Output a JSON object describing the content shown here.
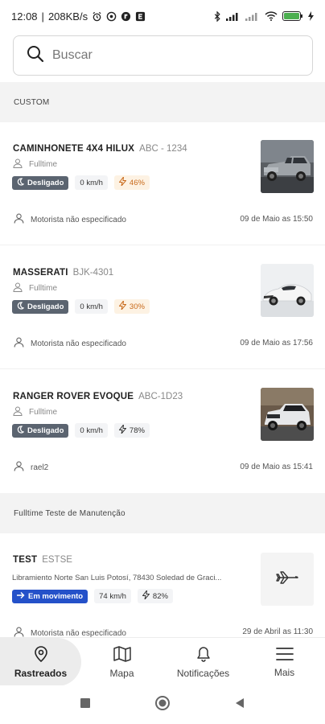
{
  "status_bar": {
    "time": "12:08",
    "speed": "208KB/s",
    "battery_icon": "battery-icon"
  },
  "search": {
    "placeholder": "Buscar"
  },
  "sections": [
    {
      "title": "CUSTOM",
      "vehicles": [
        {
          "name": "CAMINHONETE 4X4 HILUX",
          "plate": "ABC - 1234",
          "group": "Fulltime",
          "status": "Desligado",
          "speed": "0 km/h",
          "battery": "46%",
          "driver": "Motorista não especificado",
          "time": "09 de Maio as 15:50",
          "image": "pickup-truck-photo"
        },
        {
          "name": "MASSERATI",
          "plate": "BJK-4301",
          "group": "Fulltime",
          "status": "Desligado",
          "speed": "0 km/h",
          "battery": "30%",
          "driver": "Motorista não especificado",
          "time": "09 de Maio as 17:56",
          "image": "sports-car-photo"
        },
        {
          "name": "RANGER ROVER EVOQUE",
          "plate": "ABC-1D23",
          "group": "Fulltime",
          "status": "Desligado",
          "speed": "0 km/h",
          "battery": "78%",
          "driver": "rael2",
          "time": "09 de Maio as 15:41",
          "image": "suv-photo"
        }
      ]
    },
    {
      "title": "Fulltime Teste de Manutenção",
      "vehicles": [
        {
          "name": "TEST",
          "plate": "ESTSE",
          "address": "Libramiento Norte San Luis Potosí, 78430 Soledad de Graci...",
          "status": "Em movimento",
          "speed": "74 km/h",
          "battery": "82%",
          "driver": "Motorista não especificado",
          "time": "29 de Abril as 11:30",
          "image": "airplane-icon"
        }
      ]
    }
  ],
  "bottom_nav": [
    {
      "label": "Rastreados",
      "icon": "location-pin-icon",
      "active": true
    },
    {
      "label": "Mapa",
      "icon": "map-icon",
      "active": false
    },
    {
      "label": "Notificações",
      "icon": "bell-icon",
      "active": false
    },
    {
      "label": "Mais",
      "icon": "menu-icon",
      "active": false
    }
  ],
  "colors": {
    "status_off": "#5b6470",
    "status_moving": "#2451c9",
    "battery_warn": "#c8691a",
    "section_bg": "#f3f3f3"
  }
}
